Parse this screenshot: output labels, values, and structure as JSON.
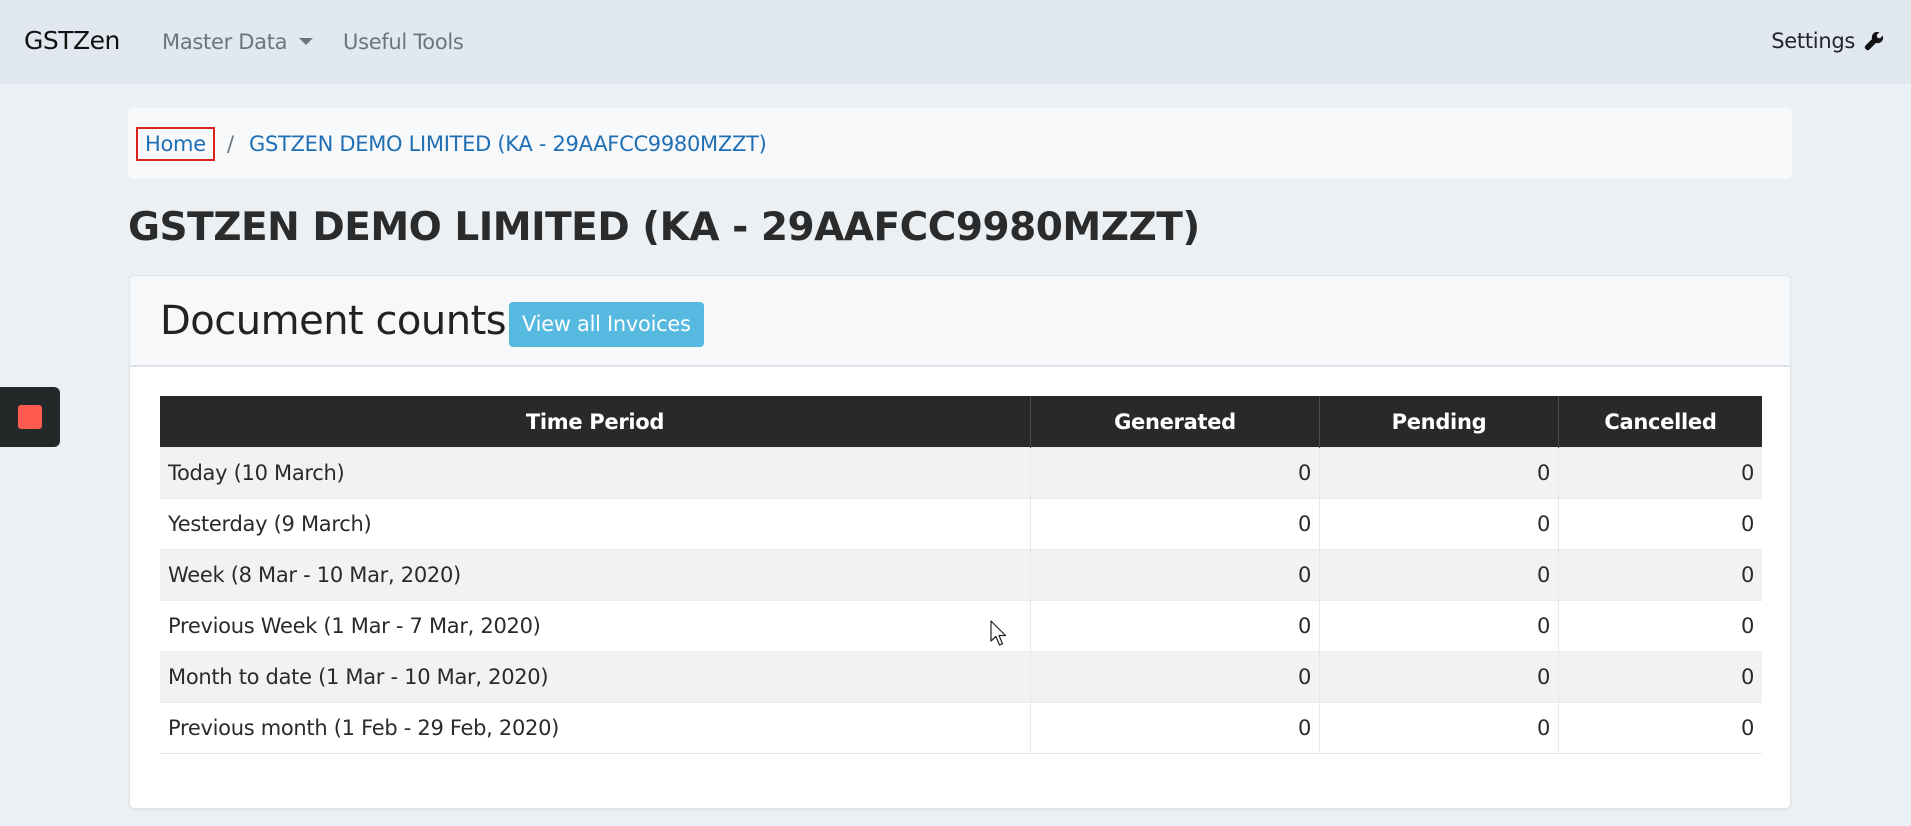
{
  "navbar": {
    "brand": "GSTZen",
    "items": [
      {
        "label": "Master Data",
        "has_dropdown": true
      },
      {
        "label": "Useful Tools",
        "has_dropdown": false
      }
    ],
    "settings_label": "Settings",
    "settings_icon": "wrench-icon"
  },
  "breadcrumb": {
    "items": [
      {
        "label": "Home"
      },
      {
        "label": "GSTZEN DEMO LIMITED (KA - 29AAFCC9980MZZT)"
      }
    ],
    "separator": "/"
  },
  "page_title": "GSTZEN DEMO LIMITED (KA - 29AAFCC9980MZZT)",
  "document_counts": {
    "title": "Document counts",
    "view_all_button": "View all Invoices",
    "button_color": "#56b9e0",
    "columns": [
      "Time Period",
      "Generated",
      "Pending",
      "Cancelled"
    ],
    "rows": [
      {
        "period": "Today (10 March)",
        "generated": "0",
        "pending": "0",
        "cancelled": "0"
      },
      {
        "period": "Yesterday (9 March)",
        "generated": "0",
        "pending": "0",
        "cancelled": "0"
      },
      {
        "period": "Week (8 Mar - 10 Mar, 2020)",
        "generated": "0",
        "pending": "0",
        "cancelled": "0"
      },
      {
        "period": "Previous Week (1 Mar - 7 Mar, 2020)",
        "generated": "0",
        "pending": "0",
        "cancelled": "0"
      },
      {
        "period": "Month to date (1 Mar - 10 Mar, 2020)",
        "generated": "0",
        "pending": "0",
        "cancelled": "0"
      },
      {
        "period": "Previous month (1 Feb - 29 Feb, 2020)",
        "generated": "0",
        "pending": "0",
        "cancelled": "0"
      }
    ]
  },
  "recorder_widget": {
    "icon": "stop-icon",
    "color": "#ff5a4f"
  }
}
